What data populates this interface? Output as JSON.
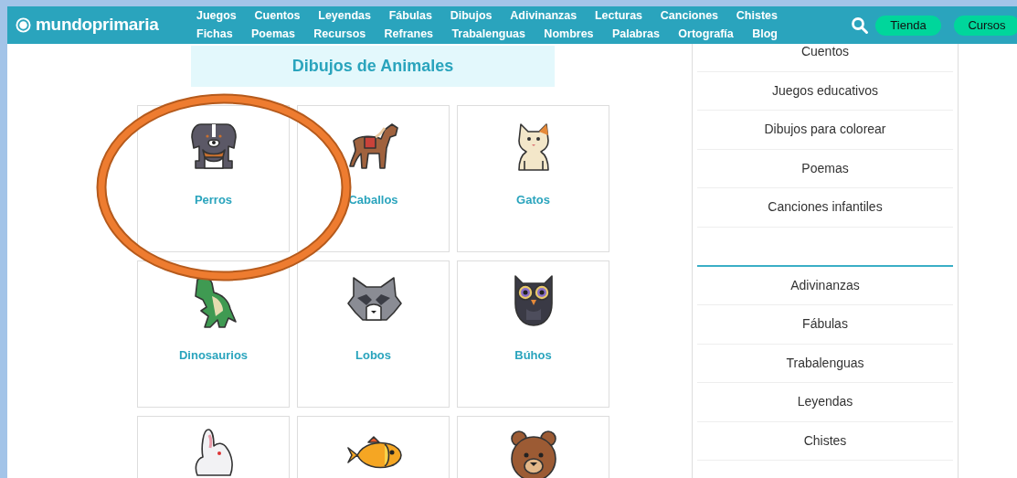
{
  "header": {
    "logo": "mundoprimaria",
    "nav_rows": [
      [
        "Juegos",
        "Cuentos",
        "Leyendas",
        "Fábulas",
        "Dibujos",
        "Adivinanzas",
        "Lecturas",
        "Canciones",
        "Chistes"
      ],
      [
        "Fichas",
        "Poemas",
        "Recursos",
        "Refranes",
        "Trabalenguas",
        "Nombres",
        "Palabras",
        "Ortografía",
        "Blog"
      ]
    ],
    "buttons": [
      "Tienda",
      "Cursos"
    ]
  },
  "heading": "Dibujos de Animales",
  "animals": [
    {
      "label": "Perros"
    },
    {
      "label": "Caballos"
    },
    {
      "label": "Gatos"
    },
    {
      "label": "Dinosaurios"
    },
    {
      "label": "Lobos"
    },
    {
      "label": "Búhos"
    }
  ],
  "sidebar": {
    "groups": [
      [
        "Cuentos",
        "Juegos educativos",
        "Dibujos para colorear",
        "Poemas",
        "Canciones infantiles"
      ],
      [
        "Adivinanzas",
        "Fábulas",
        "Trabalenguas",
        "Leyendas",
        "Chistes"
      ]
    ]
  }
}
